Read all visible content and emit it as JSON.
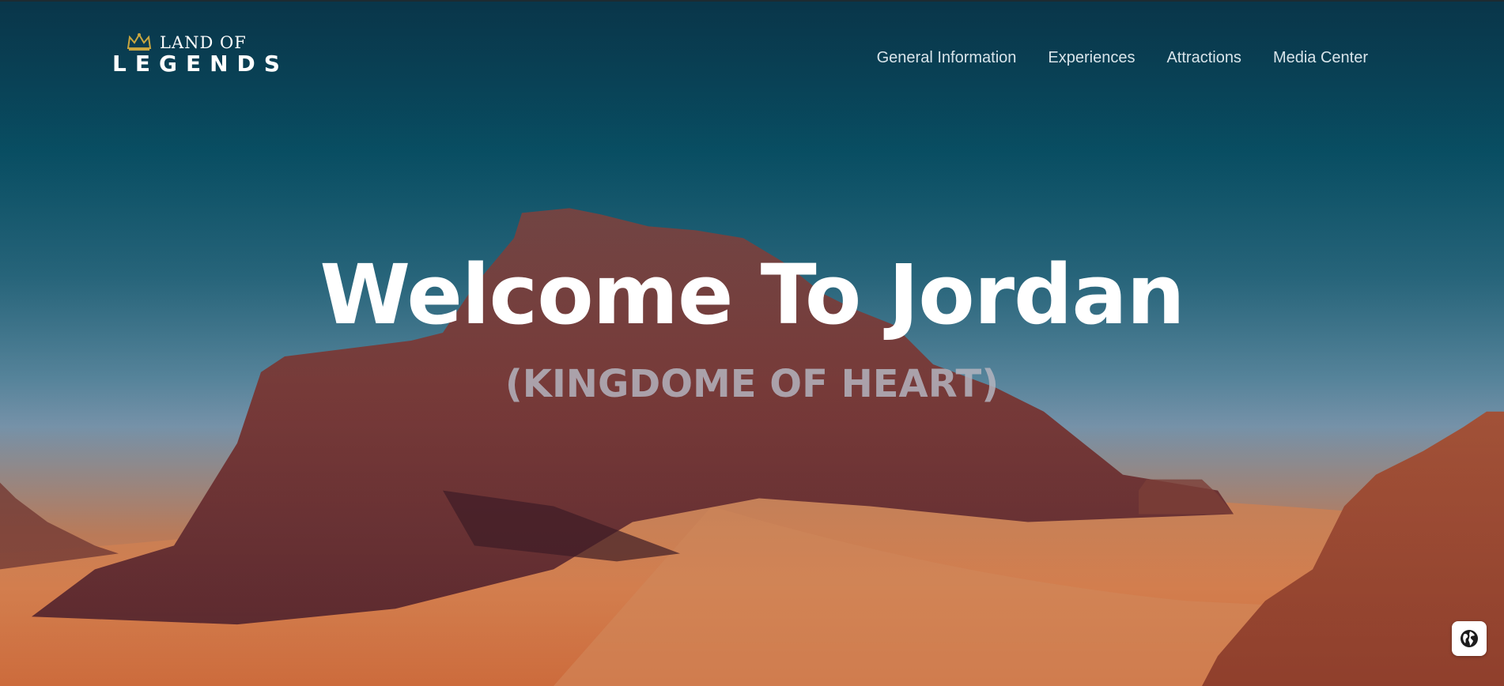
{
  "logo": {
    "line1": "LAND OF",
    "line2": "LEGENDS",
    "crown_icon": "crown-icon",
    "crown_color": "#c9a640"
  },
  "nav": {
    "items": [
      {
        "label": "General Information"
      },
      {
        "label": "Experiences"
      },
      {
        "label": "Attractions"
      },
      {
        "label": "Media Center"
      }
    ]
  },
  "hero": {
    "title": "Welcome To Jordan",
    "subtitle": "(KINGDOME OF HEART)",
    "background": "desert-rock-landscape"
  },
  "language_button": {
    "icon": "globe-icon"
  }
}
